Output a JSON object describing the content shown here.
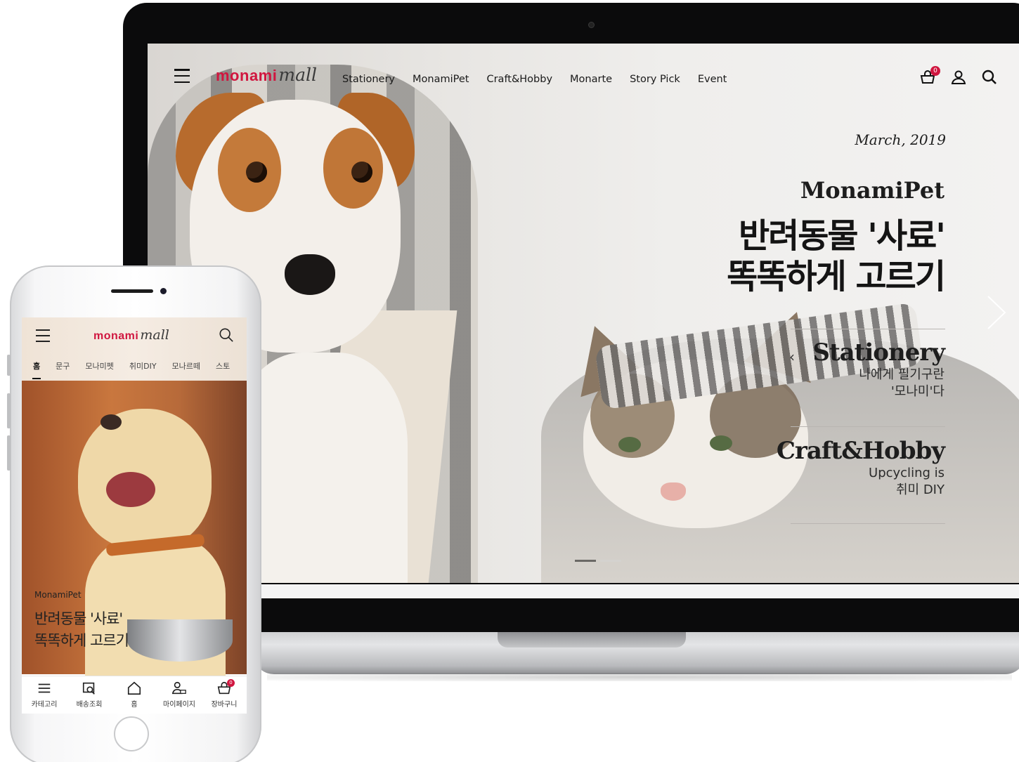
{
  "laptop": {
    "logo": {
      "brand": "monami",
      "suffix": "mall"
    },
    "menu": [
      {
        "label": "Stationery"
      },
      {
        "label": "MonamiPet"
      },
      {
        "label": "Craft&Hobby"
      },
      {
        "label": "Monarte"
      },
      {
        "label": "Story Pick"
      },
      {
        "label": "Event"
      }
    ],
    "icons": {
      "cart": "cart-icon",
      "user": "user-icon",
      "search": "search-icon"
    },
    "cart_count": "0",
    "hero": {
      "date": "March, 2019",
      "brand": "MonamiPet",
      "title_line1": "반려동물 '사료'",
      "title_line2": "똑똑하게 고르기"
    },
    "sub_items": [
      {
        "heading": "Stationery",
        "line1": "나에게 필기구란",
        "line2": "'모나미'다"
      },
      {
        "heading": "Craft&Hobby",
        "line1": "Upcycling is",
        "line2": "취미 DIY"
      }
    ],
    "pager": {
      "total": 2,
      "active": 1
    }
  },
  "phone": {
    "logo": {
      "brand": "monami",
      "suffix": "mall"
    },
    "tabs": [
      {
        "label": "홈"
      },
      {
        "label": "문구"
      },
      {
        "label": "모나미펫"
      },
      {
        "label": "취미DIY"
      },
      {
        "label": "모나르떼"
      },
      {
        "label": "스토"
      }
    ],
    "hero": {
      "brand": "MonamiPet",
      "title_line1": "반려동물 '사료'",
      "title_line2": "똑똑하게 고르기"
    },
    "bottom_nav": [
      {
        "label": "카테고리",
        "icon": "menu-icon"
      },
      {
        "label": "배송조회",
        "icon": "delivery-icon"
      },
      {
        "label": "홈",
        "icon": "home-icon"
      },
      {
        "label": "마이페이지",
        "icon": "my-page-icon"
      },
      {
        "label": "장바구니",
        "icon": "cart-icon"
      }
    ],
    "cart_count": "0"
  },
  "colors": {
    "brand": "#d0163f",
    "text": "#1d1d1d"
  }
}
